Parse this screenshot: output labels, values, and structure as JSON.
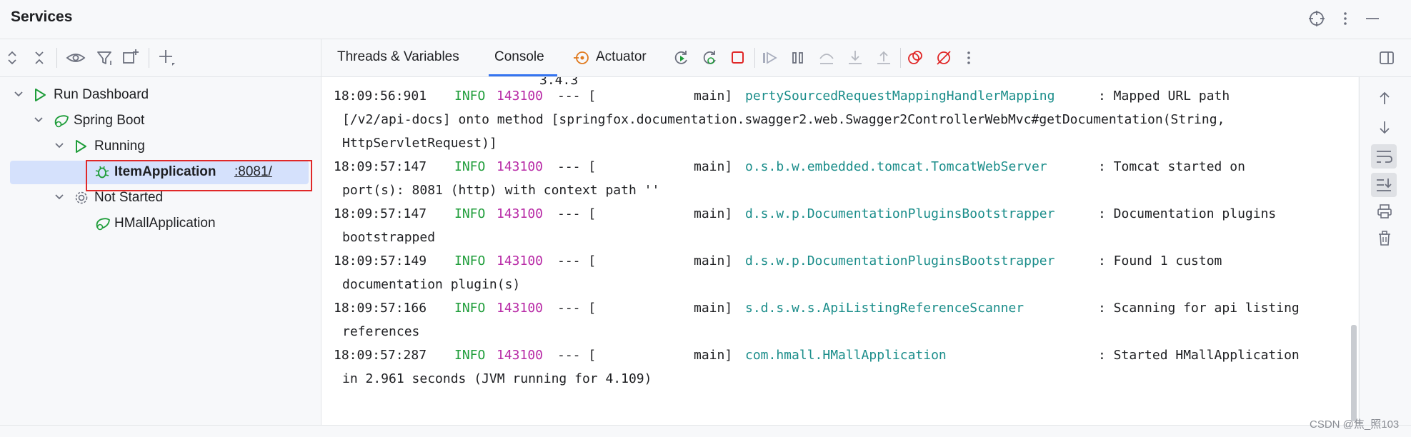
{
  "window": {
    "title": "Services"
  },
  "left_toolbar": {
    "icons": [
      "expand-all-icon",
      "collapse-all-icon",
      "eye-icon",
      "filter-icon",
      "new-group-icon",
      "add-icon"
    ]
  },
  "tree": {
    "root": "Run Dashboard",
    "group": "Spring Boot",
    "running_label": "Running",
    "running_app": "ItemApplication",
    "running_app_port": ":8081/",
    "not_started_label": "Not Started",
    "not_started_app": "HMallApplication"
  },
  "tabs": {
    "threads": "Threads & Variables",
    "console": "Console",
    "actuator": "Actuator",
    "active": "Console"
  },
  "console": {
    "partial_top": "3.4.3",
    "lines": [
      {
        "time": "18:09:56:901",
        "level": "INFO",
        "pid": "143100",
        "sep": "--- [",
        "thread": "main]",
        "logger": "pertySourcedRequestMappingHandlerMapping",
        "msg": ": Mapped URL path",
        "cont": "[/v2/api-docs] onto method [springfox.documentation.swagger2.web.Swagger2ControllerWebMvc#getDocumentation(String,",
        "cont2": "HttpServletRequest)]"
      },
      {
        "time": "18:09:57:147",
        "level": "INFO",
        "pid": "143100",
        "sep": "--- [",
        "thread": "main]",
        "logger": "o.s.b.w.embedded.tomcat.TomcatWebServer",
        "msg": ": Tomcat started on",
        "cont": "port(s): 8081 (http) with context path ''"
      },
      {
        "time": "18:09:57:147",
        "level": "INFO",
        "pid": "143100",
        "sep": "--- [",
        "thread": "main]",
        "logger": "d.s.w.p.DocumentationPluginsBootstrapper",
        "msg": ": Documentation plugins",
        "cont": "bootstrapped"
      },
      {
        "time": "18:09:57:149",
        "level": "INFO",
        "pid": "143100",
        "sep": "--- [",
        "thread": "main]",
        "logger": "d.s.w.p.DocumentationPluginsBootstrapper",
        "msg": ": Found 1 custom",
        "cont": "documentation plugin(s)"
      },
      {
        "time": "18:09:57:166",
        "level": "INFO",
        "pid": "143100",
        "sep": "--- [",
        "thread": "main]",
        "logger": "s.d.s.w.s.ApiListingReferenceScanner",
        "msg": ": Scanning for api listing",
        "cont": "references"
      },
      {
        "time": "18:09:57:287",
        "level": "INFO",
        "pid": "143100",
        "sep": "--- [",
        "thread": "main]",
        "logger": "com.hmall.HMallApplication",
        "msg": ": Started HMallApplication",
        "cont": "in 2.961 seconds (JVM running for 4.109)"
      }
    ]
  },
  "watermark": "CSDN @焦_照103",
  "colors": {
    "accent": "#3574f0",
    "run_green": "#1f9d3a",
    "stop_red": "#e02828",
    "actuator_orange": "#e07a1f"
  }
}
